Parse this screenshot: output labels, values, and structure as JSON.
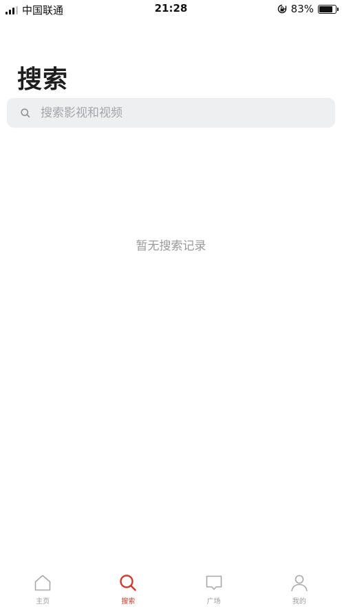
{
  "status_bar": {
    "carrier": "中国联通",
    "time": "21:28",
    "battery": "83%",
    "battery_level": 0.83
  },
  "page": {
    "title": "搜索"
  },
  "search": {
    "placeholder": "搜索影视和视频",
    "value": ""
  },
  "empty_state": {
    "text": "暂无搜索记录"
  },
  "tab_bar": {
    "items": [
      {
        "label": "主页",
        "icon": "home-icon"
      },
      {
        "label": "搜索",
        "icon": "search-icon",
        "active": true
      },
      {
        "label": "广场",
        "icon": "chat-bubble-icon"
      },
      {
        "label": "我的",
        "icon": "user-icon"
      }
    ]
  },
  "colors": {
    "accent": "#d03b2f",
    "search_bg": "#eeeff1",
    "inactive": "#9c9c9c"
  }
}
